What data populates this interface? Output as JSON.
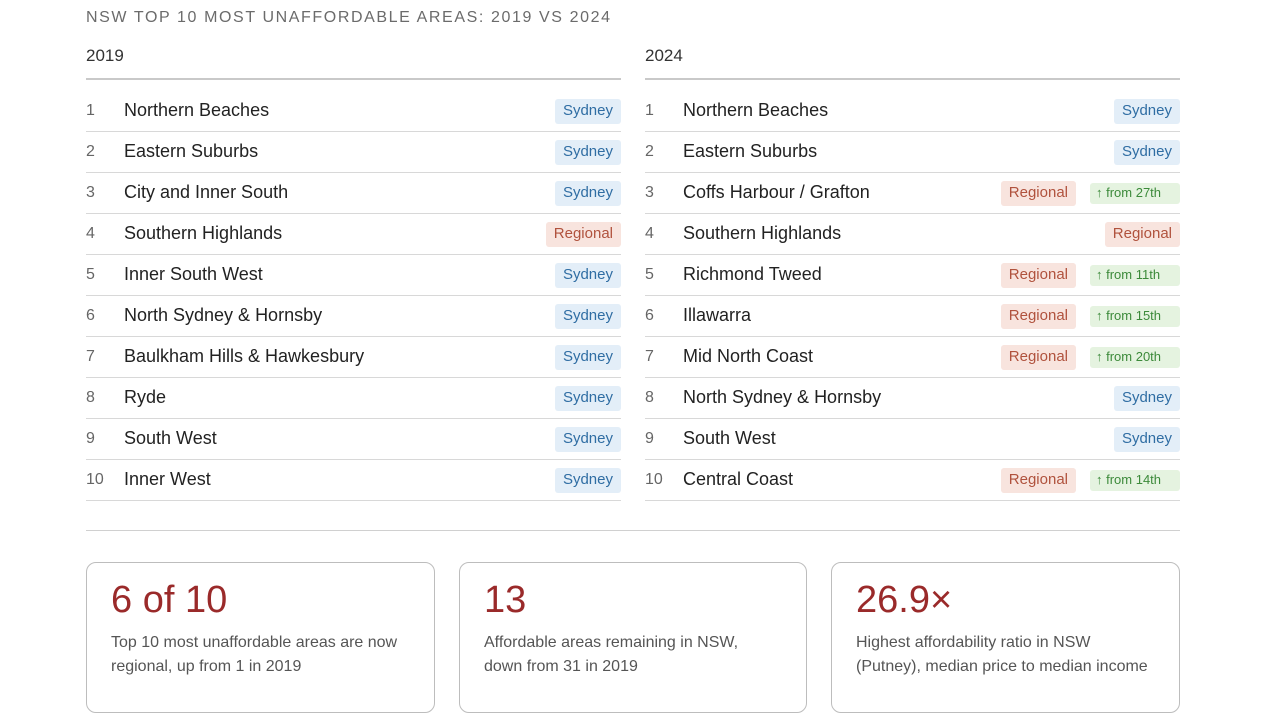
{
  "title": "NSW TOP 10 MOST UNAFFORDABLE AREAS: 2019 VS 2024",
  "colors": {
    "sydney_bg": "#e3eef8",
    "sydney_text": "#2f6da3",
    "regional_bg": "#f8e4de",
    "regional_text": "#b0523d",
    "movement_bg": "#e5f3e0",
    "movement_text": "#3c8a3a",
    "stat_value": "#9a2a2a"
  },
  "columns": [
    {
      "heading": "2019",
      "rows": [
        {
          "rank": "1",
          "name": "Northern Beaches",
          "tag": "Sydney",
          "type": "sydney",
          "movement": ""
        },
        {
          "rank": "2",
          "name": "Eastern Suburbs",
          "tag": "Sydney",
          "type": "sydney",
          "movement": ""
        },
        {
          "rank": "3",
          "name": "City and Inner South",
          "tag": "Sydney",
          "type": "sydney",
          "movement": ""
        },
        {
          "rank": "4",
          "name": "Southern Highlands",
          "tag": "Regional",
          "type": "regional",
          "movement": ""
        },
        {
          "rank": "5",
          "name": "Inner South West",
          "tag": "Sydney",
          "type": "sydney",
          "movement": ""
        },
        {
          "rank": "6",
          "name": "North Sydney & Hornsby",
          "tag": "Sydney",
          "type": "sydney",
          "movement": ""
        },
        {
          "rank": "7",
          "name": "Baulkham Hills & Hawkesbury",
          "tag": "Sydney",
          "type": "sydney",
          "movement": ""
        },
        {
          "rank": "8",
          "name": "Ryde",
          "tag": "Sydney",
          "type": "sydney",
          "movement": ""
        },
        {
          "rank": "9",
          "name": "South West",
          "tag": "Sydney",
          "type": "sydney",
          "movement": ""
        },
        {
          "rank": "10",
          "name": "Inner West",
          "tag": "Sydney",
          "type": "sydney",
          "movement": ""
        }
      ]
    },
    {
      "heading": "2024",
      "rows": [
        {
          "rank": "1",
          "name": "Northern Beaches",
          "tag": "Sydney",
          "type": "sydney",
          "movement": ""
        },
        {
          "rank": "2",
          "name": "Eastern Suburbs",
          "tag": "Sydney",
          "type": "sydney",
          "movement": ""
        },
        {
          "rank": "3",
          "name": "Coffs Harbour / Grafton",
          "tag": "Regional",
          "type": "regional",
          "movement": "↑ from 27th"
        },
        {
          "rank": "4",
          "name": "Southern Highlands",
          "tag": "Regional",
          "type": "regional",
          "movement": ""
        },
        {
          "rank": "5",
          "name": "Richmond Tweed",
          "tag": "Regional",
          "type": "regional",
          "movement": "↑ from 11th"
        },
        {
          "rank": "6",
          "name": "Illawarra",
          "tag": "Regional",
          "type": "regional",
          "movement": "↑ from 15th"
        },
        {
          "rank": "7",
          "name": "Mid North Coast",
          "tag": "Regional",
          "type": "regional",
          "movement": "↑ from 20th"
        },
        {
          "rank": "8",
          "name": "North Sydney & Hornsby",
          "tag": "Sydney",
          "type": "sydney",
          "movement": ""
        },
        {
          "rank": "9",
          "name": "South West",
          "tag": "Sydney",
          "type": "sydney",
          "movement": ""
        },
        {
          "rank": "10",
          "name": "Central Coast",
          "tag": "Regional",
          "type": "regional",
          "movement": "↑ from 14th"
        }
      ]
    }
  ],
  "stats": [
    {
      "value": "6 of 10",
      "line1": "Top 10 most unaffordable areas are now",
      "line2": "regional, up from 1 in 2019"
    },
    {
      "value": "13",
      "line1": "Affordable areas remaining in NSW,",
      "line2": "down from 31 in 2019"
    },
    {
      "value": "26.9×",
      "line1": "Highest affordability ratio in NSW",
      "line2": "(Putney), median price to median income"
    }
  ]
}
